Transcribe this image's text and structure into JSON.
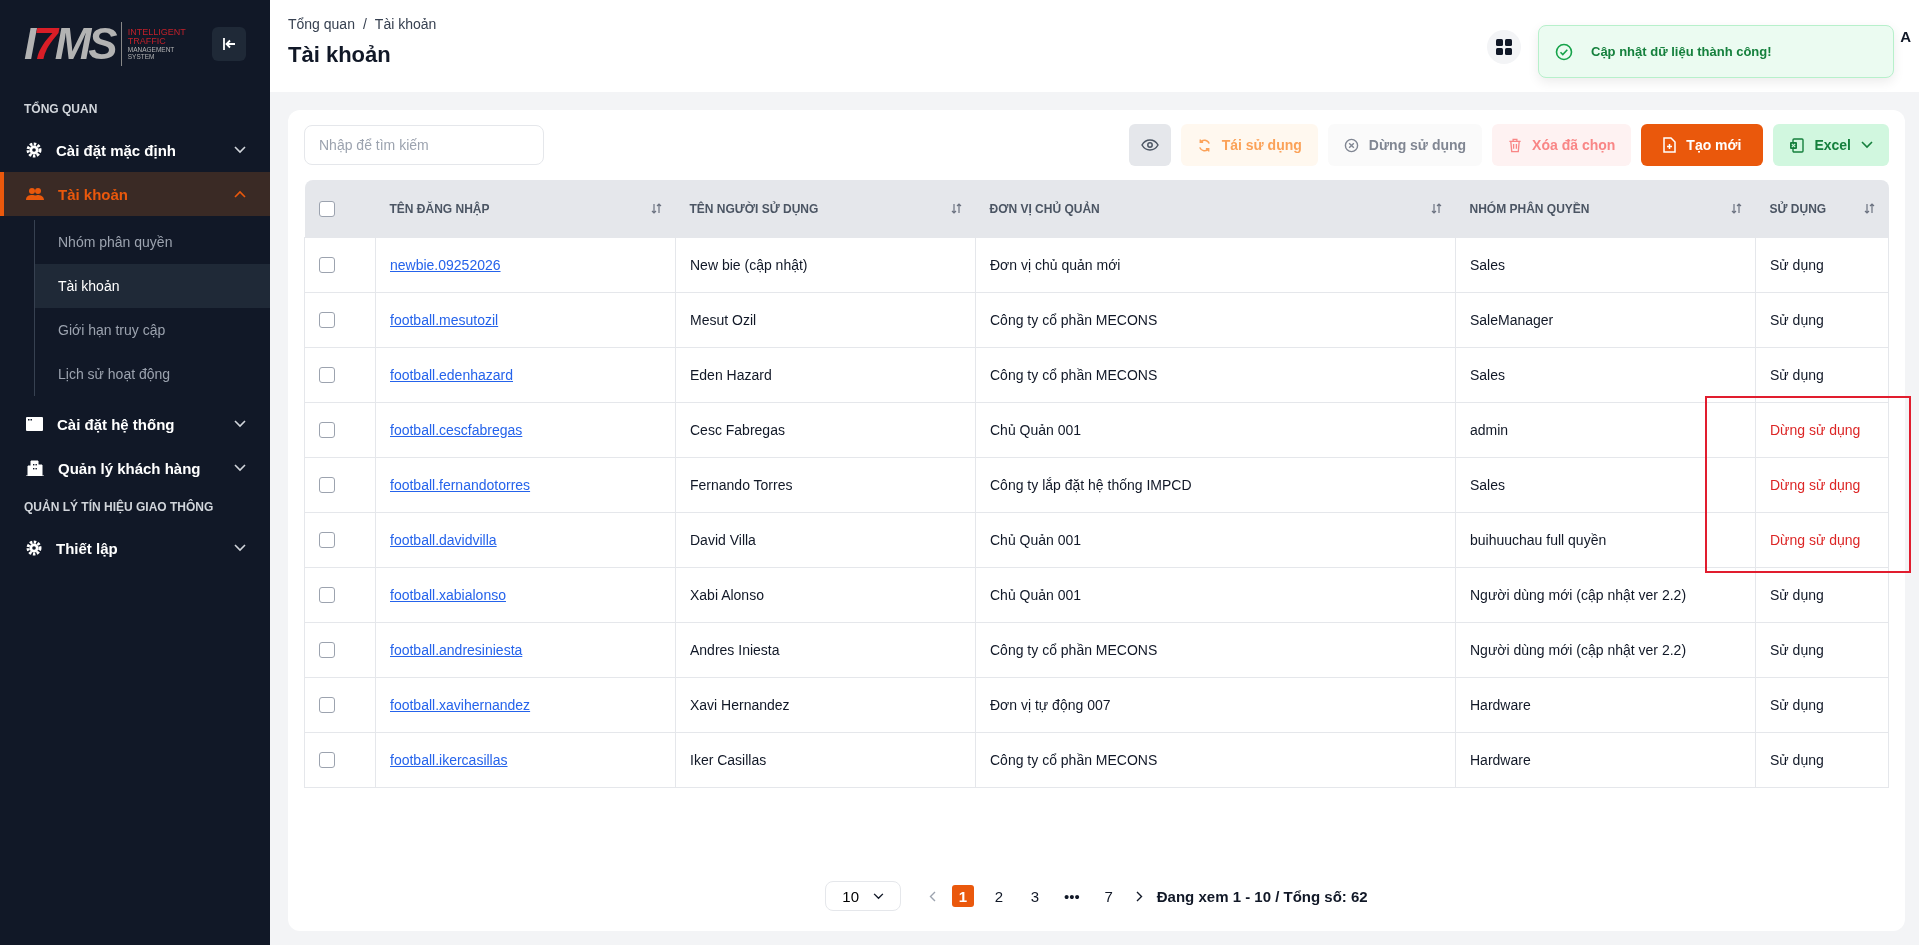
{
  "sidebar": {
    "logo_mark": "I7MS",
    "logo_tagline_top": "INTELLIGENT TRAFFIC",
    "logo_tagline_bottom": "MANAGEMENT SYSTEM",
    "nav": [
      {
        "kind": "section",
        "label": "TỔNG QUAN"
      },
      {
        "kind": "item",
        "label": "Cài đặt mặc định",
        "expanded": false,
        "selected": false
      },
      {
        "kind": "item",
        "label": "Tài khoản",
        "expanded": true,
        "selected": true,
        "children": [
          {
            "label": "Nhóm phân quyền",
            "selected": false
          },
          {
            "label": "Tài khoản",
            "selected": true
          },
          {
            "label": "Giới hạn truy cập",
            "selected": false
          },
          {
            "label": "Lịch sử hoạt động",
            "selected": false
          }
        ]
      },
      {
        "kind": "item",
        "label": "Cài đặt hệ thống",
        "expanded": false,
        "selected": false
      },
      {
        "kind": "item",
        "label": "Quản lý khách hàng",
        "expanded": false,
        "selected": false
      },
      {
        "kind": "section",
        "label": "QUẢN LÝ TÍN HIỆU GIAO THÔNG"
      },
      {
        "kind": "item",
        "label": "Thiết lập",
        "expanded": false,
        "selected": false
      }
    ]
  },
  "header": {
    "breadcrumb": [
      "Tổng quan",
      "Tài khoản"
    ],
    "breadcrumb_separator": "/",
    "title": "Tài khoản",
    "user_visible": "A"
  },
  "toast": {
    "message": "Cập nhật dữ liệu thành công!"
  },
  "search": {
    "placeholder": "Nhập để tìm kiếm"
  },
  "toolbar": [
    {
      "kind": "view",
      "disabled": false
    },
    {
      "kind": "reuse",
      "label": "Tái sử dụng",
      "disabled": true
    },
    {
      "kind": "stop",
      "label": "Dừng sử dụng",
      "disabled": true
    },
    {
      "kind": "delete",
      "label": "Xóa đã chọn",
      "disabled": true
    },
    {
      "kind": "create",
      "label": "Tạo mới",
      "disabled": false
    },
    {
      "kind": "export",
      "label": "Excel",
      "disabled": false
    }
  ],
  "table": {
    "all_checked": false,
    "columns": [
      "TÊN ĐĂNG NHẬP",
      "TÊN NGƯỜI SỬ DỤNG",
      "ĐƠN VỊ CHỦ QUẢN",
      "NHÓM PHÂN QUYỀN",
      "SỬ DỤNG"
    ],
    "rows": [
      {
        "checked": false,
        "login": "newbie.09252026",
        "name": "New bie (cập nhật)",
        "unit": "Đơn vị chủ quản mới",
        "group": "Sales",
        "status": "Sử dụng",
        "active": true,
        "outlined": false
      },
      {
        "checked": false,
        "login": "football.mesutozil",
        "name": "Mesut Ozil",
        "unit": "Công ty cổ phần MECONS",
        "group": "SaleManager",
        "status": "Sử dụng",
        "active": true,
        "outlined": false
      },
      {
        "checked": false,
        "login": "football.edenhazard",
        "name": "Eden Hazard",
        "unit": "Công ty cổ phần MECONS",
        "group": "Sales",
        "status": "Sử dụng",
        "active": true,
        "outlined": false
      },
      {
        "checked": false,
        "login": "football.cescfabregas",
        "name": "Cesc Fabregas",
        "unit": "Chủ Quản 001",
        "group": "admin",
        "status": "Dừng sử dụng",
        "active": false,
        "outlined": true
      },
      {
        "checked": false,
        "login": "football.fernandotorres",
        "name": "Fernando Torres",
        "unit": "Công ty lắp đặt hệ thống IMPCD",
        "group": "Sales",
        "status": "Dừng sử dụng",
        "active": false,
        "outlined": true
      },
      {
        "checked": false,
        "login": "football.davidvilla",
        "name": "David Villa",
        "unit": "Chủ Quản 001",
        "group": "buihuuchau full quyền",
        "status": "Dừng sử dụng",
        "active": false,
        "outlined": true
      },
      {
        "checked": false,
        "login": "football.xabialonso",
        "name": "Xabi Alonso",
        "unit": "Chủ Quản 001",
        "group": "Người dùng mới (cập nhật ver 2.2)",
        "status": "Sử dụng",
        "active": true,
        "outlined": false
      },
      {
        "checked": false,
        "login": "football.andresiniesta",
        "name": "Andres Iniesta",
        "unit": "Công ty cổ phần MECONS",
        "group": "Người dùng mới (cập nhật ver 2.2)",
        "status": "Sử dụng",
        "active": true,
        "outlined": false
      },
      {
        "checked": false,
        "login": "football.xavihernandez",
        "name": "Xavi Hernandez",
        "unit": "Đơn vị tự động 007",
        "group": "Hardware",
        "status": "Sử dụng",
        "active": true,
        "outlined": false
      },
      {
        "checked": false,
        "login": "football.ikercasillas",
        "name": "Iker Casillas",
        "unit": "Công ty cổ phần MECONS",
        "group": "Hardware",
        "status": "Sử dụng",
        "active": true,
        "outlined": false
      }
    ]
  },
  "pagination": {
    "page_size": "10",
    "pages": [
      {
        "label": "1",
        "selected": true
      },
      {
        "label": "2",
        "selected": false
      },
      {
        "label": "3",
        "selected": false
      },
      {
        "label": "•••",
        "selected": false
      },
      {
        "label": "7",
        "selected": false
      }
    ],
    "summary": "Đang xem 1 - 10 / Tổng số: 62"
  }
}
